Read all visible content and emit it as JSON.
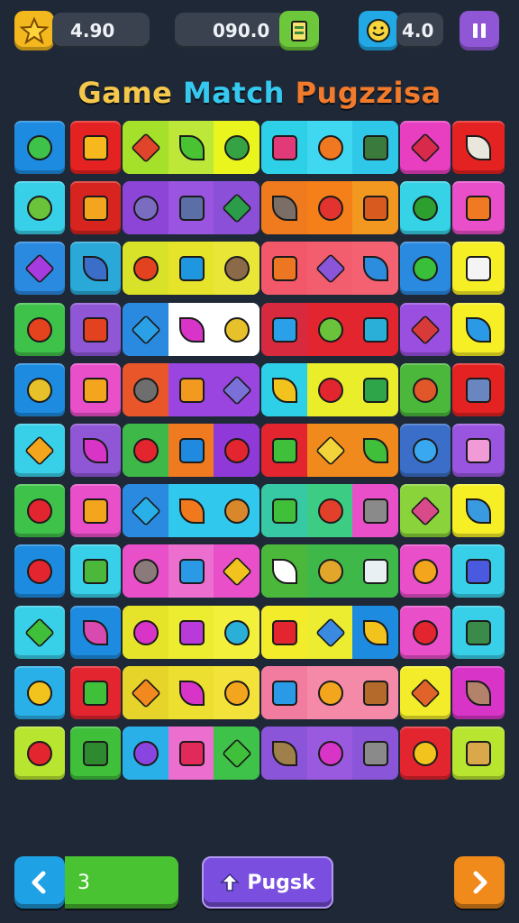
{
  "hud": {
    "stars_value": "4.90",
    "score_value": "090.0",
    "coins_value": "4.0"
  },
  "title": {
    "part1": "Game",
    "part2": "Match",
    "part3": "Pugzzisa"
  },
  "footer": {
    "level_value": "3",
    "action_label": "Pugsk"
  },
  "colors": {
    "background": "#1f2836",
    "star_tile": "#f3b81d",
    "score_icon_tile": "#6cc83a",
    "coin_icon_tile": "#22a8e4",
    "pause_tile": "#8f57d6",
    "back_button": "#1fa1e6",
    "level_bar": "#49c332",
    "action_button": "#7a4fe0",
    "next_button": "#f08a1b"
  },
  "icons": {
    "star": "star-icon",
    "score": "clipboard-icon",
    "coin": "smiley-coin-icon",
    "pause": "pause-icon",
    "back": "chevron-left-icon",
    "action": "upload-icon",
    "next": "chevron-right-icon"
  },
  "board": {
    "rows": [
      [
        [
          "#1c8be0",
          "#3fc24a"
        ],
        [
          "#e52222",
          "#f6b81c"
        ],
        [
          "#a5e02a",
          "#e0442a",
          "#bde83a",
          "#49c332",
          "#e9f51c",
          "#35a343"
        ],
        [
          "#2ed0e8",
          "#e23a79",
          "#3fd8f0",
          "#f07820",
          "#2fc8e8",
          "#3a7a3c"
        ],
        [
          "#e83fc1",
          "#d82b4c"
        ],
        [
          "#e52222",
          "#e9e6dc"
        ]
      ],
      [
        [
          "#38d0e8",
          "#6ac33a"
        ],
        [
          "#d8241f",
          "#f2a51d"
        ],
        [
          "#8d45d8",
          "#7a6cc0",
          "#9a55e0",
          "#5b6fa6",
          "#8b4fd8",
          "#2b9d4a"
        ],
        [
          "#f07a1e",
          "#7a6e66",
          "#f57f18",
          "#e2332e",
          "#f29720",
          "#d85a1e"
        ],
        [
          "#36d3e6",
          "#2c9f2f"
        ],
        [
          "#e84fc9",
          "#f07a24"
        ]
      ],
      [
        [
          "#2a8ae0",
          "#a63be0"
        ],
        [
          "#2aa8d8",
          "#3a6ec8"
        ],
        [
          "#d8e228",
          "#e2421f",
          "#e6e42a",
          "#1f96e0",
          "#eae638",
          "#8a6a48"
        ],
        [
          "#f2586a",
          "#ec7621",
          "#f25e6e",
          "#8a55d8",
          "#f46272",
          "#2c8ddf"
        ],
        [
          "#2a8ae0",
          "#3abf3a"
        ],
        [
          "#f7ef26",
          "#f4f4f4"
        ]
      ],
      [
        [
          "#3fc24a",
          "#e5421e"
        ],
        [
          "#8f57d6",
          "#e2421f"
        ],
        [
          "#2a8ae0",
          "#2aa0e6",
          "#ffffff",
          "#d835c8",
          "#ffffff",
          "#e6c12a"
        ],
        [
          "#d82a3f",
          "#2aa0e8",
          "#e2252f",
          "#6ac33a",
          "#e2252f",
          "#2ab0d8"
        ],
        [
          "#9a4fe0",
          "#d83a3a"
        ],
        [
          "#f7ef26",
          "#2a9ae6"
        ]
      ],
      [
        [
          "#1c8be0",
          "#e6c12a"
        ],
        [
          "#e84fc9",
          "#f2a51d"
        ],
        [
          "#e9562a",
          "#6e6e6e",
          "#9a45e0",
          "#f29a20",
          "#9a45e0",
          "#7a70d8"
        ],
        [
          "#2ed0e8",
          "#f2c31d",
          "#e9ed2a",
          "#e2252f",
          "#e9ed2a",
          "#2fa54a"
        ],
        [
          "#4bb83b",
          "#e2572a"
        ],
        [
          "#e52222",
          "#6a86c0"
        ]
      ],
      [
        [
          "#38d0e8",
          "#f2a51d"
        ],
        [
          "#8f57d6",
          "#d835c8"
        ],
        [
          "#3fb84a",
          "#e2252f",
          "#f07a20",
          "#1f8ae0",
          "#8f3ad8",
          "#e2252f"
        ],
        [
          "#e2252f",
          "#3fbf3a",
          "#f08a1c",
          "#f2d43a",
          "#f08a1c",
          "#3fbf3a"
        ],
        [
          "#3a6ec8",
          "#3aa8f0"
        ],
        [
          "#9a55e0",
          "#f09ad8"
        ]
      ],
      [
        [
          "#3fc24a",
          "#e2252f"
        ],
        [
          "#e84fc9",
          "#f2a51d"
        ],
        [
          "#2a8ae0",
          "#2ab0e8",
          "#30c8ec",
          "#f0791e",
          "#30c8ec",
          "#d8882a"
        ],
        [
          "#36c9a4",
          "#3fbf3a",
          "#3dcc84",
          "#e2402a",
          "#e84fc9",
          "#8a8a8a"
        ],
        [
          "#8ad33a",
          "#d84a8a"
        ],
        [
          "#f7ef26",
          "#3a9ae0"
        ]
      ],
      [
        [
          "#1c8be0",
          "#e2252f"
        ],
        [
          "#38d0e8",
          "#4bb83b"
        ],
        [
          "#e84fc9",
          "#8a7a7a",
          "#ec6fd0",
          "#2a9ae6",
          "#e84fc9",
          "#f2c31d"
        ],
        [
          "#4bb83b",
          "#ffffff",
          "#3fb84a",
          "#e2a72a",
          "#3fb84a",
          "#e8f0f4"
        ],
        [
          "#e84fc9",
          "#f2a51d"
        ],
        [
          "#38d0e8",
          "#4a5ae0"
        ]
      ],
      [
        [
          "#38d0e8",
          "#3fbf3a"
        ],
        [
          "#1c8be0",
          "#d84ab0"
        ],
        [
          "#e6e42a",
          "#d835c8",
          "#ecec30",
          "#b83ad8",
          "#f2f03a",
          "#2ab0d8"
        ],
        [
          "#f2ec2a",
          "#e2252f",
          "#ecec30",
          "#3a8ae0",
          "#1c8be0",
          "#f2c31d"
        ],
        [
          "#e84fc9",
          "#e2252f"
        ],
        [
          "#38d0e8",
          "#3a8a4a"
        ]
      ],
      [
        [
          "#2ab0e8",
          "#f2c31d"
        ],
        [
          "#e2252f",
          "#3fbf3a"
        ],
        [
          "#e6d42a",
          "#f2891e",
          "#ecdf30",
          "#d835c8",
          "#f2e23a",
          "#f2a51d"
        ],
        [
          "#f27ca0",
          "#2a9ae6",
          "#f58aa8",
          "#f2a51d",
          "#f58aa8",
          "#b46a2a"
        ],
        [
          "#f2ec2a",
          "#e2632a"
        ],
        [
          "#d835c8",
          "#b2826a"
        ]
      ],
      [
        [
          "#b8e630",
          "#e2252f"
        ],
        [
          "#3fbf3a",
          "#2f8a2f"
        ],
        [
          "#2ab0e8",
          "#8a45e0",
          "#ec6fd0",
          "#e22a5a",
          "#3fc24a",
          "#3fbf3a"
        ],
        [
          "#8a55d8",
          "#a0804a",
          "#9a5ae0",
          "#d835c8",
          "#8a55d8",
          "#8a8a8a"
        ],
        [
          "#e2252f",
          "#f2c31d"
        ],
        [
          "#b8e630",
          "#d8a84a"
        ]
      ]
    ]
  }
}
